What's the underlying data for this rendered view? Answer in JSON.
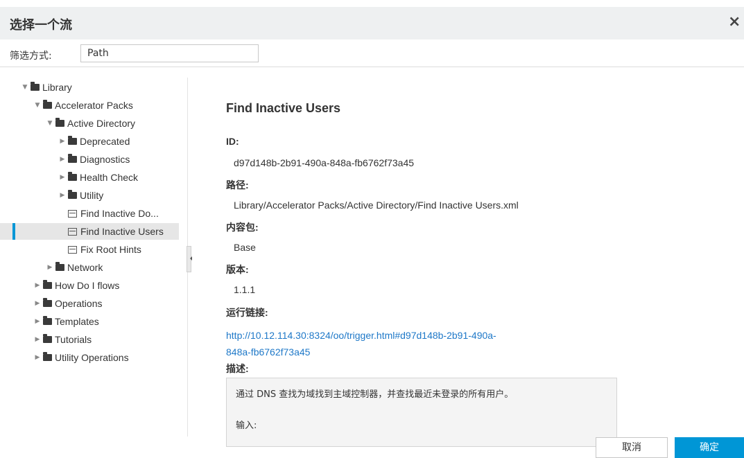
{
  "dialog": {
    "title": "选择一个流",
    "close": "×"
  },
  "filter": {
    "label": "筛选方式:",
    "value": "Path"
  },
  "tree": {
    "items": [
      {
        "label": "Library",
        "kind": "folder",
        "expanded": true,
        "depth": 0
      },
      {
        "label": "Accelerator Packs",
        "kind": "folder",
        "expanded": true,
        "depth": 1
      },
      {
        "label": "Active Directory",
        "kind": "folder",
        "expanded": true,
        "depth": 2
      },
      {
        "label": "Deprecated",
        "kind": "folder",
        "expanded": false,
        "depth": 3
      },
      {
        "label": "Diagnostics",
        "kind": "folder",
        "expanded": false,
        "depth": 3
      },
      {
        "label": "Health Check",
        "kind": "folder",
        "expanded": false,
        "depth": 3
      },
      {
        "label": "Utility",
        "kind": "folder",
        "expanded": false,
        "depth": 3
      },
      {
        "label": "Find Inactive Do...",
        "kind": "flow",
        "depth": 3
      },
      {
        "label": "Find Inactive Users",
        "kind": "flow",
        "depth": 3,
        "selected": true
      },
      {
        "label": "Fix Root Hints",
        "kind": "flow",
        "depth": 3
      },
      {
        "label": "Network",
        "kind": "folder",
        "expanded": false,
        "depth": 2
      },
      {
        "label": "How Do I flows",
        "kind": "folder",
        "expanded": false,
        "depth": 1
      },
      {
        "label": "Operations",
        "kind": "folder",
        "expanded": false,
        "depth": 1
      },
      {
        "label": "Templates",
        "kind": "folder",
        "expanded": false,
        "depth": 1
      },
      {
        "label": "Tutorials",
        "kind": "folder",
        "expanded": false,
        "depth": 1
      },
      {
        "label": "Utility Operations",
        "kind": "folder",
        "expanded": false,
        "depth": 1
      }
    ]
  },
  "details": {
    "title": "Find Inactive Users",
    "id_label": "ID:",
    "id_value": "d97d148b-2b91-490a-848a-fb6762f73a45",
    "path_label": "路径:",
    "path_value": "Library/Accelerator Packs/Active Directory/Find Inactive Users.xml",
    "pack_label": "内容包:",
    "pack_value": "Base",
    "version_label": "版本:",
    "version_value": "1.1.1",
    "run_link_label": "运行链接:",
    "run_link_line1": "http://10.12.114.30:8324/oo/trigger.html#d97d148b-2b91-490a-",
    "run_link_line2": "848a-fb6762f73a45",
    "desc_label": "描述:",
    "desc_line1": "通过 DNS 查找为域找到主域控制器，并查找最近未登录的所有用户。",
    "desc_line2": "输入:"
  },
  "buttons": {
    "cancel": "取消",
    "ok": "确定"
  },
  "colors": {
    "accent": "#0096d6",
    "link": "#1e78c8",
    "titlebar": "#eef0f1"
  }
}
